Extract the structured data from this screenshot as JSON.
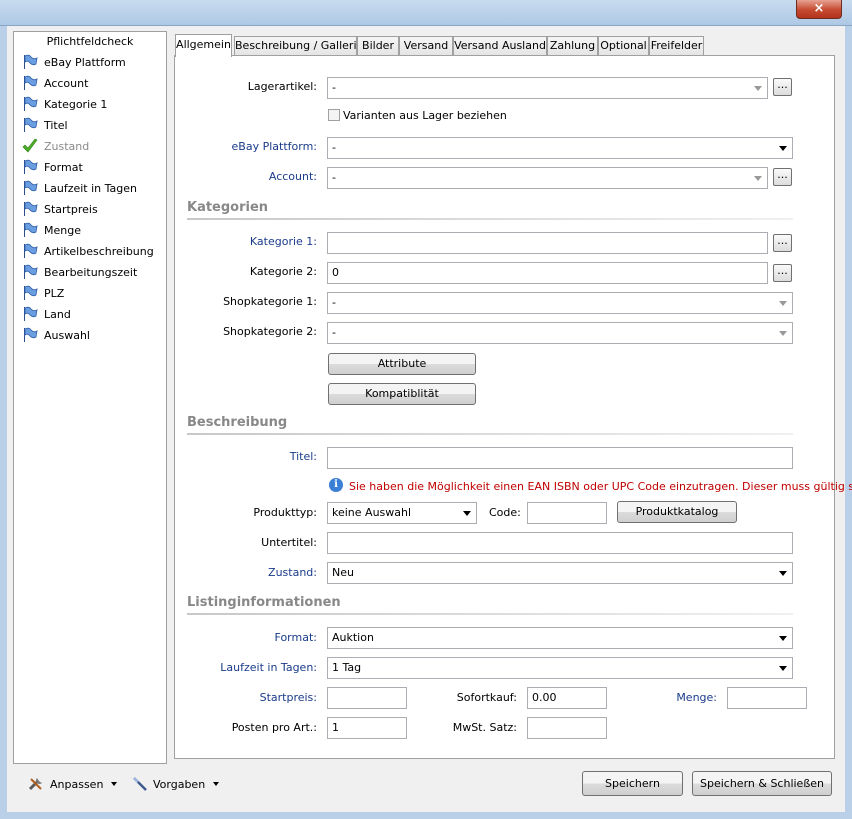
{
  "window": {
    "close_glyph": "×"
  },
  "sidebar": {
    "title": "Pflichtfeldcheck",
    "items": [
      {
        "label": "eBay Plattform",
        "icon": "flag-icon",
        "done": false
      },
      {
        "label": "Account",
        "icon": "flag-icon",
        "done": false
      },
      {
        "label": "Kategorie 1",
        "icon": "flag-icon",
        "done": false
      },
      {
        "label": "Titel",
        "icon": "flag-icon",
        "done": false
      },
      {
        "label": "Zustand",
        "icon": "checkmark-icon",
        "done": true
      },
      {
        "label": "Format",
        "icon": "flag-icon",
        "done": false
      },
      {
        "label": "Laufzeit in Tagen",
        "icon": "flag-icon",
        "done": false
      },
      {
        "label": "Startpreis",
        "icon": "flag-icon",
        "done": false
      },
      {
        "label": "Menge",
        "icon": "flag-icon",
        "done": false
      },
      {
        "label": "Artikelbeschreibung",
        "icon": "flag-icon",
        "done": false
      },
      {
        "label": "Bearbeitungszeit",
        "icon": "flag-icon",
        "done": false
      },
      {
        "label": "PLZ",
        "icon": "flag-icon",
        "done": false
      },
      {
        "label": "Land",
        "icon": "flag-icon",
        "done": false
      },
      {
        "label": "Auswahl",
        "icon": "flag-icon",
        "done": false
      }
    ]
  },
  "tabs": [
    "Allgemein",
    "Beschreibung / Gallerie",
    "Bilder",
    "Versand",
    "Versand Ausland",
    "Zahlung",
    "Optional",
    "Freifelder"
  ],
  "general": {
    "lagerartikel_label": "Lagerartikel:",
    "lagerartikel_value": "-",
    "varianten_label": "Varianten aus Lager beziehen",
    "plattform_label": "eBay Plattform:",
    "plattform_value": "-",
    "account_label": "Account:",
    "account_value": "-",
    "dots": "..."
  },
  "kategorien": {
    "heading": "Kategorien",
    "kat1_label": "Kategorie 1:",
    "kat1_value": "",
    "kat2_label": "Kategorie 2:",
    "kat2_value": "0",
    "shop1_label": "Shopkategorie 1:",
    "shop1_value": "-",
    "shop2_label": "Shopkategorie 2:",
    "shop2_value": "-",
    "attribute_button": "Attribute",
    "kompat_button": "Kompatiblität"
  },
  "beschreibung": {
    "heading": "Beschreibung",
    "titel_label": "Titel:",
    "titel_value": "",
    "info_glyph": "i",
    "info_text": "Sie haben die Möglichkeit einen EAN ISBN oder UPC Code einzutragen. Dieser muss gültig sein.",
    "produkttyp_label": "Produkttyp:",
    "produkttyp_value": "keine Auswahl",
    "code_label": "Code:",
    "code_value": "",
    "produktkatalog_button": "Produktkatalog",
    "untertitel_label": "Untertitel:",
    "untertitel_value": "",
    "zustand_label": "Zustand:",
    "zustand_value": "Neu"
  },
  "listing": {
    "heading": "Listinginformationen",
    "format_label": "Format:",
    "format_value": "Auktion",
    "laufzeit_label": "Laufzeit in Tagen:",
    "laufzeit_value": "1 Tag",
    "startpreis_label": "Startpreis:",
    "startpreis_value": "",
    "sofortkauf_label": "Sofortkauf:",
    "sofortkauf_value": "0.00",
    "menge_label": "Menge:",
    "menge_value": "",
    "posten_label": "Posten pro Art.:",
    "posten_value": "1",
    "mwst_label": "MwSt. Satz:",
    "mwst_value": ""
  },
  "footer": {
    "anpassen": "Anpassen",
    "vorgaben": "Vorgaben",
    "speichern": "Speichern",
    "speichern_schliessen": "Speichern & Schließen"
  }
}
